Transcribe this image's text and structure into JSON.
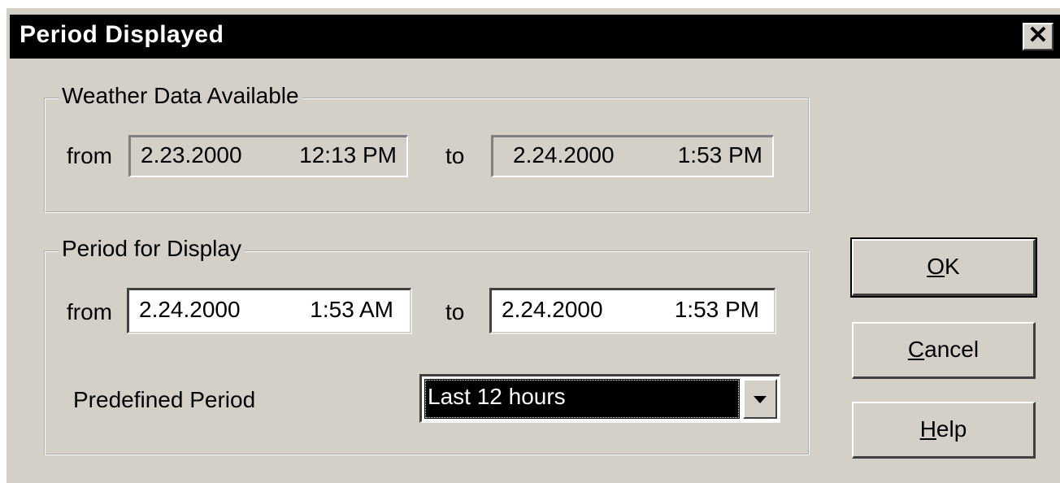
{
  "dialog": {
    "title": "Period Displayed",
    "close_glyph": "✕"
  },
  "weather_data_available": {
    "label": "Weather Data Available",
    "from_label": "from",
    "to_label": "to",
    "from_date": "2.23.2000",
    "from_time": "12:13 PM",
    "to_date": "2.24.2000",
    "to_time": "1:53 PM"
  },
  "period_for_display": {
    "label": "Period for Display",
    "from_label": "from",
    "to_label": "to",
    "from_date": "2.24.2000",
    "from_time": "1:53 AM",
    "to_date": "2.24.2000",
    "to_time": "1:53 PM",
    "predefined_label": "Predefined Period",
    "predefined_value": "Last 12 hours"
  },
  "buttons": {
    "ok_mnemonic": "O",
    "ok_rest": "K",
    "cancel_mnemonic": "C",
    "cancel_rest": "ancel",
    "help_mnemonic": "H",
    "help_rest": "elp"
  },
  "icons": {
    "close": "close-icon",
    "dropdown": "chevron-down-icon"
  }
}
